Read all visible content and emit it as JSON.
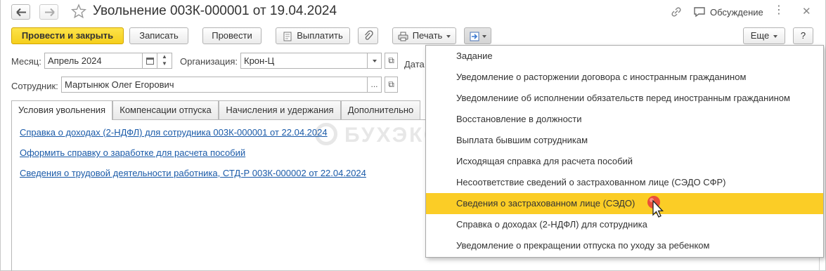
{
  "window": {
    "title": "Увольнение 003К-000001 от 19.04.2024",
    "discussion_label": "Обсуждение",
    "more_label": "⋮",
    "close_label": "✕"
  },
  "toolbar": {
    "post_close_label": "Провести и закрыть",
    "save_label": "Записать",
    "post_label": "Провести",
    "pay_label": "Выплатить",
    "print_label": "Печать",
    "more_label": "Еще",
    "help_label": "?"
  },
  "form": {
    "month_label": "Месяц:",
    "month_value": "Апрель 2024",
    "org_label": "Организация:",
    "org_value": "Крон-Ц",
    "date_label": "Дата",
    "employee_label": "Сотрудник:",
    "employee_value": "Мартынюк Олег Егорович",
    "select_btn": "...",
    "open_btn": "⧉"
  },
  "tabs": [
    {
      "label": "Условия увольнения"
    },
    {
      "label": "Компенсации отпуска"
    },
    {
      "label": "Начисления и удержания"
    },
    {
      "label": "Дополнительно"
    }
  ],
  "links": [
    {
      "label": "Справка о доходах (2-НДФЛ) для сотрудника 003К-000001 от 22.04.2024"
    },
    {
      "label": "Оформить справку о заработке для расчета пособий"
    },
    {
      "label": "Сведения о трудовой деятельности работника, СТД-Р 003К-000002 от 22.04.2024"
    }
  ],
  "watermark": {
    "text": "БУХЭКСПЕРТ"
  },
  "dropdown": {
    "selected_index": 7,
    "items": [
      {
        "label": "Задание"
      },
      {
        "label": "Уведомление о расторжении договора с иностранным гражданином"
      },
      {
        "label": "Уведомлениие об исполнении обязательств перед иностранным гражданином"
      },
      {
        "label": "Восстановление в должности"
      },
      {
        "label": "Выплата бывшим сотрудникам"
      },
      {
        "label": "Исходящая справка для расчета пособий"
      },
      {
        "label": "Несоответствие сведений о застрахованном лице (СЭДО СФР)"
      },
      {
        "label": "Сведения о застрахованном лице (СЭДО)"
      },
      {
        "label": "Справка о доходах (2-НДФЛ) для сотрудника"
      },
      {
        "label": "Уведомление о прекращении отпуска по уходу за ребенком"
      }
    ]
  },
  "colors": {
    "accent_yellow": "#fbcd26",
    "link_blue": "#1a5aa8",
    "cursor_red": "#e8413c"
  }
}
